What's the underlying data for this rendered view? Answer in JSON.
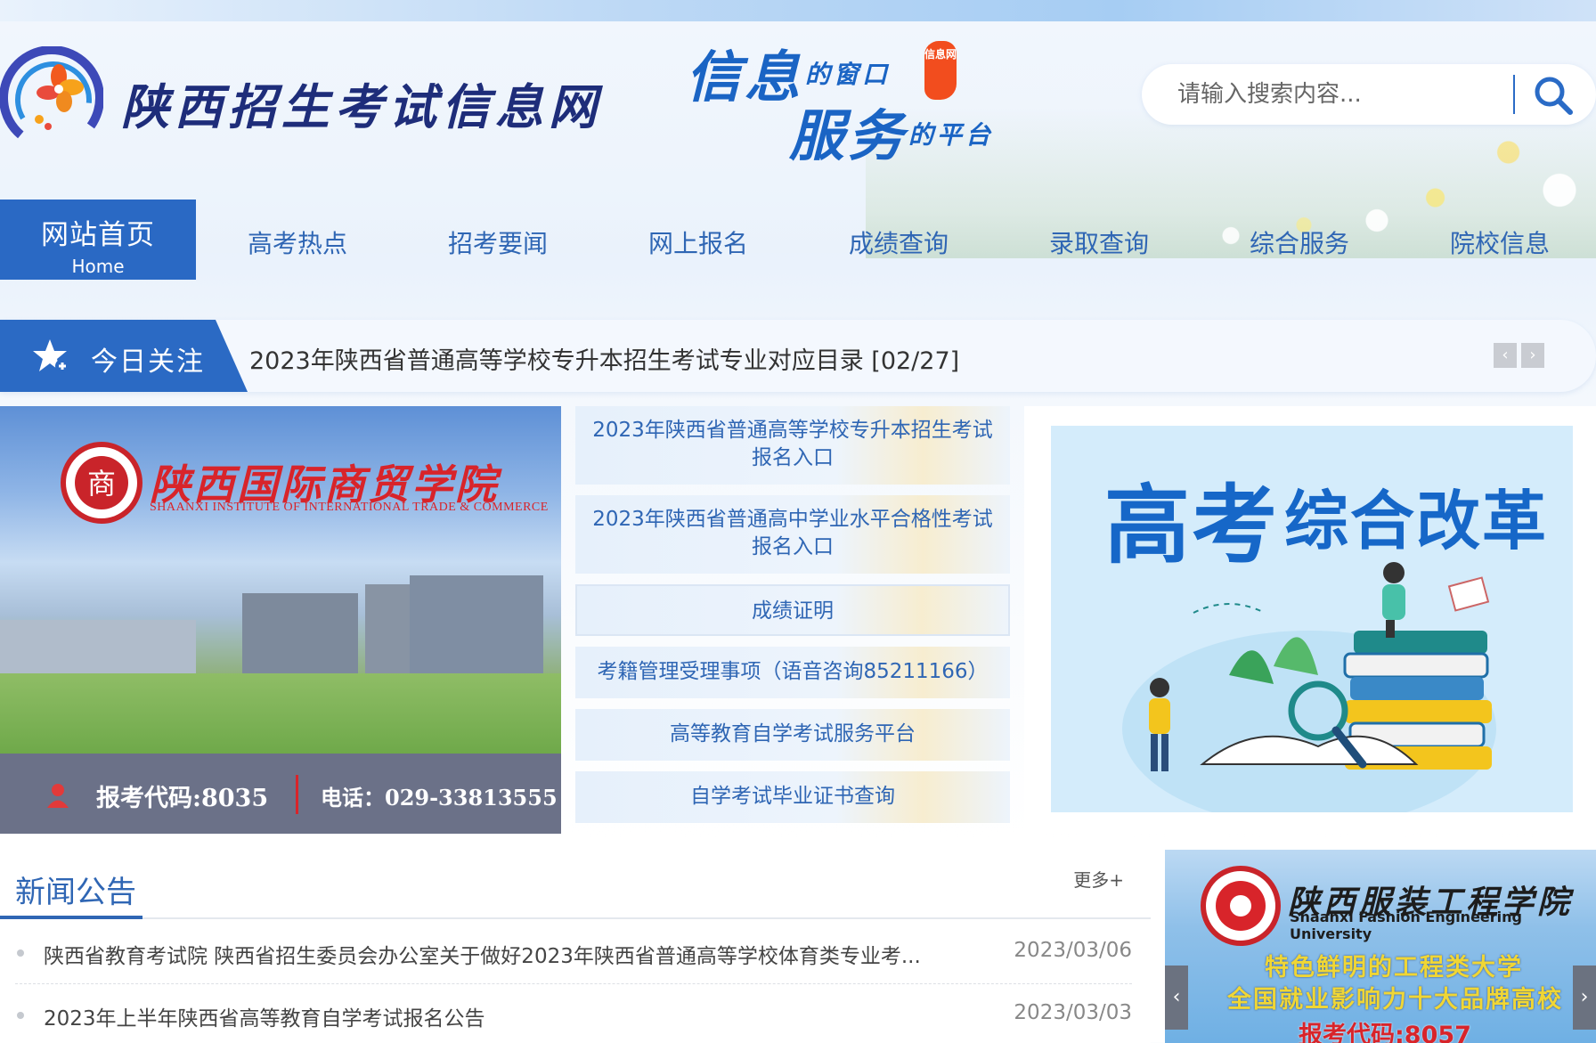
{
  "header": {
    "site_title": "陕西招生考试信息网",
    "slogan_line1_big": "信息",
    "slogan_line1_small": "的窗口",
    "slogan_line2_big": "服务",
    "slogan_line2_small": "的平台",
    "slogan_seal": "信息网",
    "search_placeholder": "请输入搜索内容..."
  },
  "nav": {
    "home_zh": "网站首页",
    "home_en": "Home",
    "items": [
      "高考热点",
      "招考要闻",
      "网上报名",
      "成绩查询",
      "录取查询",
      "综合服务",
      "院校信息"
    ]
  },
  "focus": {
    "label": "今日关注",
    "headline": "2023年陕西省普通高等学校专升本招生考试专业对应目录  [02/27]",
    "prev": "‹",
    "next": "›"
  },
  "left_banner": {
    "school_cn": "陕西国际商贸学院",
    "school_en": "SHAANXI INSTITUTE OF INTERNATIONAL TRADE & COMMERCE",
    "emblem": "商",
    "code": "报考代码:8035",
    "tel": "电话：029-33813555"
  },
  "quick_links": [
    "2023年陕西省普通高等学校专升本招生考试报名入口",
    "2023年陕西省普通高中学业水平合格性考试报名入口",
    "成绩证明",
    "考籍管理受理事项（语音咨询85211166）",
    "高等教育自学考试服务平台",
    "自学考试毕业证书查询"
  ],
  "right_banner": {
    "title_big": "高考",
    "title_rest": "综合改革"
  },
  "news": {
    "title": "新闻公告",
    "more": "更多+",
    "items": [
      {
        "text": "陕西省教育考试院 陕西省招生委员会办公室关于做好2023年陕西省普通高等学校体育类专业考...",
        "date": "2023/03/06"
      },
      {
        "text": "2023年上半年陕西省高等教育自学考试报名公告",
        "date": "2023/03/03"
      }
    ]
  },
  "right_ad": {
    "school_cn": "陕西服装工程学院",
    "school_en": "Shaanxi Fashion Engineering University",
    "line1": "特色鲜明的工程类大学",
    "line2": "全国就业影响力十大品牌高校",
    "line3": "报考代码:8057",
    "prev": "‹",
    "next": "›"
  },
  "colors": {
    "brand_blue": "#2a69c4",
    "nav_text": "#2f66b4",
    "title_navy": "#1e2d7a"
  }
}
